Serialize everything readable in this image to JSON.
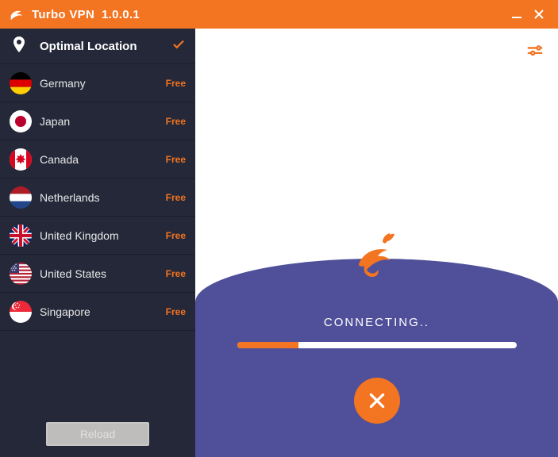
{
  "titlebar": {
    "app_name": "Turbo VPN",
    "version": "1.0.0.1"
  },
  "sidebar": {
    "optimal_label": "Optimal Location",
    "locations": [
      {
        "name": "Germany",
        "badge": "Free",
        "flag": "germany"
      },
      {
        "name": "Japan",
        "badge": "Free",
        "flag": "japan"
      },
      {
        "name": "Canada",
        "badge": "Free",
        "flag": "canada"
      },
      {
        "name": "Netherlands",
        "badge": "Free",
        "flag": "netherlands"
      },
      {
        "name": "United Kingdom",
        "badge": "Free",
        "flag": "uk"
      },
      {
        "name": "United States",
        "badge": "Free",
        "flag": "usa"
      },
      {
        "name": "Singapore",
        "badge": "Free",
        "flag": "singapore"
      }
    ],
    "reload_label": "Reload"
  },
  "main": {
    "status": "CONNECTING..",
    "progress_percent": 22
  },
  "colors": {
    "accent": "#f37421",
    "wave": "#4f5099",
    "sidebar": "#242838"
  }
}
